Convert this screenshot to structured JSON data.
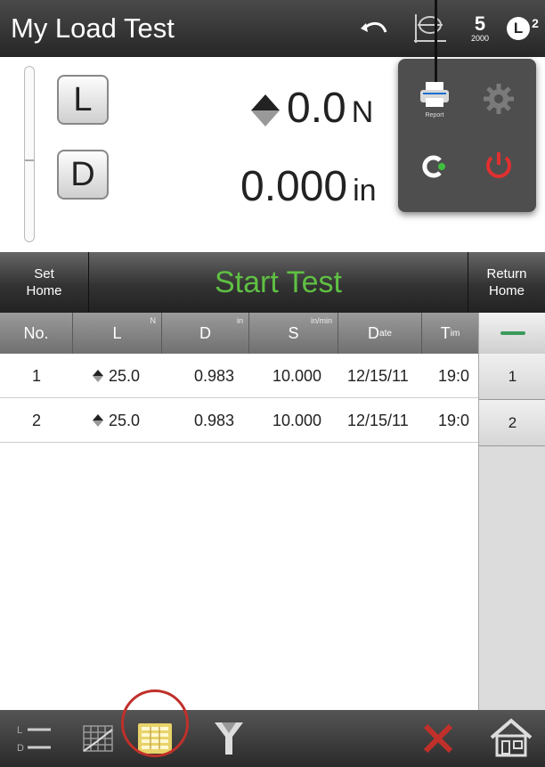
{
  "header": {
    "title": "My Load Test",
    "speed_value": "5",
    "speed_unit": "2000",
    "badge_letter": "L",
    "badge_sup": "2"
  },
  "readout": {
    "load_button": "L",
    "disp_button": "D",
    "load_value": "0.0",
    "load_unit": "N",
    "disp_value": "0.000",
    "disp_unit": "in"
  },
  "popup": {
    "print_caption": "Report",
    "icons": [
      "printer-icon",
      "gear-icon",
      "reset-icon",
      "power-icon"
    ]
  },
  "controls": {
    "set_home": [
      "Set",
      "Home"
    ],
    "start_test": "Start Test",
    "return_home": [
      "Return",
      "Home"
    ]
  },
  "table": {
    "columns": [
      {
        "main": "No.",
        "sub": "",
        "corner": ""
      },
      {
        "main": "L",
        "sub": "",
        "corner": "N"
      },
      {
        "main": "D",
        "sub": "",
        "corner": "in"
      },
      {
        "main": "S",
        "sub": "",
        "corner": "in/min"
      },
      {
        "main": "D",
        "sub": "ate",
        "corner": ""
      },
      {
        "main": "T",
        "sub": "im",
        "corner": ""
      }
    ],
    "rows": [
      {
        "no": "1",
        "load": "25.0",
        "disp": "0.983",
        "speed": "10.000",
        "date": "12/15/11",
        "time": "19:0"
      },
      {
        "no": "2",
        "load": "25.0",
        "disp": "0.983",
        "speed": "10.000",
        "date": "12/15/11",
        "time": "19:0"
      }
    ]
  },
  "sidepanel": {
    "items": [
      "1",
      "2"
    ]
  },
  "colors": {
    "start_text": "#5fc043",
    "highlight_ring": "#c0302a",
    "delete_icon": "#c0302a",
    "power_icon": "#e03030"
  },
  "bottombar": {
    "icons": [
      "ld-graph-icon",
      "grid-chart-icon",
      "table-view-icon",
      "filter-icon",
      "delete-icon",
      "home-icon"
    ]
  }
}
